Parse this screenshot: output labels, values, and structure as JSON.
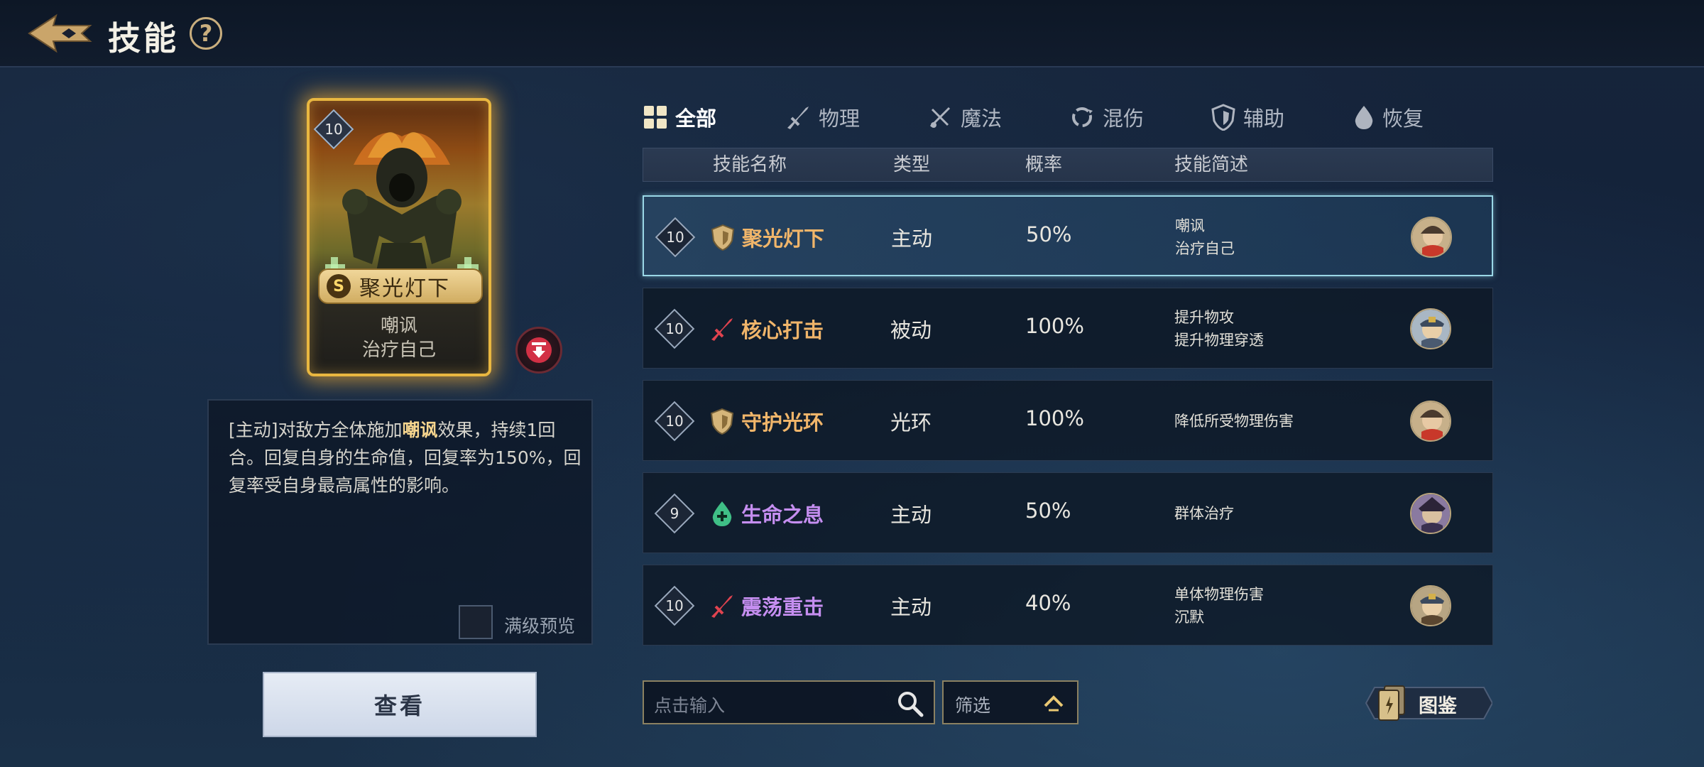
{
  "header": {
    "title": "技能",
    "help_label": "?"
  },
  "card": {
    "level": "10",
    "rank": "S",
    "name": "聚光灯下",
    "desc_line1": "嘲讽",
    "desc_line2": "治疗自己"
  },
  "description": {
    "prefix": "[主动]对敌方全体施加",
    "highlight": "嘲讽",
    "suffix": "效果，持续1回合。回复自身的生命值，回复率为150%，回复率受自身最高属性的影响。",
    "preview_label": "满级预览"
  },
  "view_button": "查看",
  "tabs": [
    {
      "label": "全部",
      "icon": "grid-icon",
      "active": true
    },
    {
      "label": "物理",
      "icon": "sword-icon",
      "active": false
    },
    {
      "label": "魔法",
      "icon": "magic-icon",
      "active": false
    },
    {
      "label": "混伤",
      "icon": "mixed-icon",
      "active": false
    },
    {
      "label": "辅助",
      "icon": "shield-icon",
      "active": false
    },
    {
      "label": "恢复",
      "icon": "drop-icon",
      "active": false
    }
  ],
  "table": {
    "headers": [
      "技能名称",
      "类型",
      "概率",
      "技能简述"
    ],
    "rows": [
      {
        "level": "10",
        "icon": "shield-icon",
        "name": "聚光灯下",
        "name_color": "#f0b56a",
        "type": "主动",
        "rate": "50%",
        "brief1": "嘲讽",
        "brief2": "治疗自己",
        "selected": true
      },
      {
        "level": "10",
        "icon": "sword-icon",
        "name": "核心打击",
        "name_color": "#f0b56a",
        "type": "被动",
        "rate": "100%",
        "brief1": "提升物攻",
        "brief2": "提升物理穿透",
        "selected": false
      },
      {
        "level": "10",
        "icon": "shield-icon",
        "name": "守护光环",
        "name_color": "#f0b56a",
        "type": "光环",
        "rate": "100%",
        "brief1": "降低所受物理伤害",
        "brief2": "",
        "selected": false
      },
      {
        "level": "9",
        "icon": "heal-drop-icon",
        "name": "生命之息",
        "name_color": "#c58ef0",
        "type": "主动",
        "rate": "50%",
        "brief1": "群体治疗",
        "brief2": "",
        "selected": false
      },
      {
        "level": "10",
        "icon": "sword-icon",
        "name": "震荡重击",
        "name_color": "#c58ef0",
        "type": "主动",
        "rate": "40%",
        "brief1": "单体物理伤害",
        "brief2": "沉默",
        "selected": false
      }
    ]
  },
  "search": {
    "placeholder": "点击输入"
  },
  "filter": {
    "label": "筛选"
  },
  "codex": {
    "label": "图鉴"
  },
  "colors": {
    "accent_gold": "#e9b740",
    "orange_name": "#f0b56a",
    "purple_name": "#c58ef0",
    "selected_border": "#9ad7e6"
  }
}
